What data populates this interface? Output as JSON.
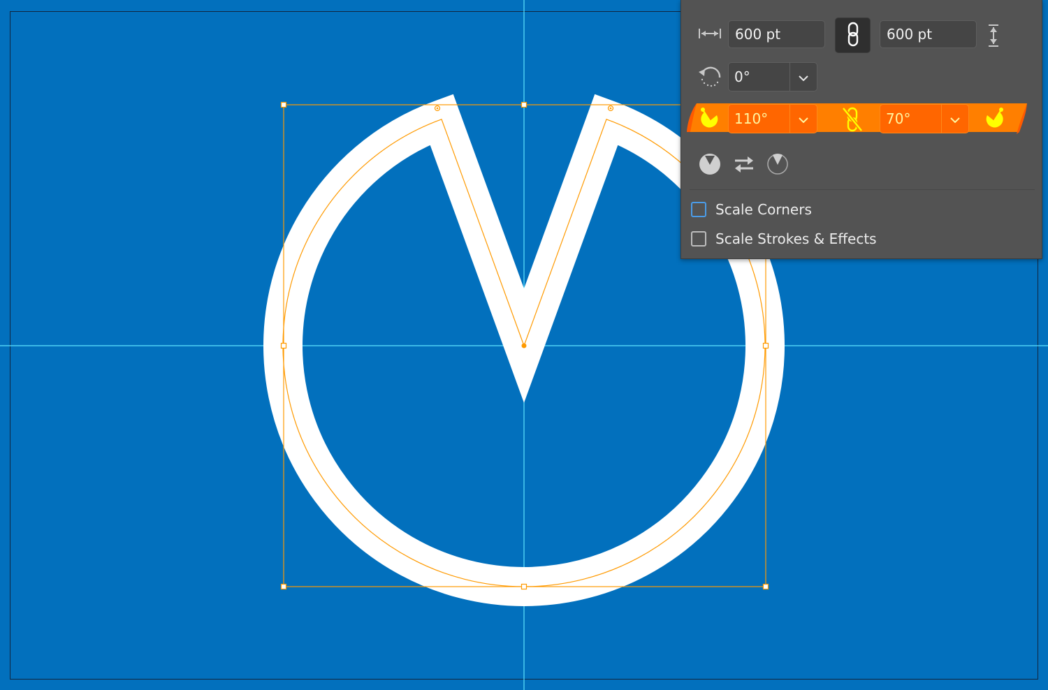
{
  "canvas": {
    "background_color": "#0270bd",
    "artboard_border_color": "#11263f",
    "guide_color": "#5ee4ff",
    "selection_color": "#ff9a00",
    "shape": {
      "type": "pie",
      "fill": "none",
      "stroke_color": "#ffffff",
      "start_angle_deg": 110,
      "end_angle_deg": 70
    }
  },
  "transform_panel": {
    "width": {
      "icon": "width-arrows-icon",
      "value": "600 pt"
    },
    "constrain_proportions": {
      "icon": "link-icon",
      "active": true
    },
    "height": {
      "icon": "height-arrows-icon",
      "value": "600 pt"
    },
    "rotation": {
      "icon": "rotate-icon",
      "value": "0°"
    },
    "pie_start_angle": {
      "icon": "pie-start-angle-icon",
      "value": "110°"
    },
    "pie_constrain": {
      "icon": "unlink-icon",
      "active": false
    },
    "pie_end_angle": {
      "icon": "pie-end-angle-icon",
      "value": "70°"
    },
    "pie_actions": [
      {
        "name": "pie-closed-icon"
      },
      {
        "name": "swap-angles-icon"
      },
      {
        "name": "pie-outline-icon"
      }
    ],
    "highlight_color": "#ff7f00",
    "checkboxes": [
      {
        "label": "Scale Corners",
        "checked": false
      },
      {
        "label": "Scale Strokes & Effects",
        "checked": false
      }
    ]
  }
}
